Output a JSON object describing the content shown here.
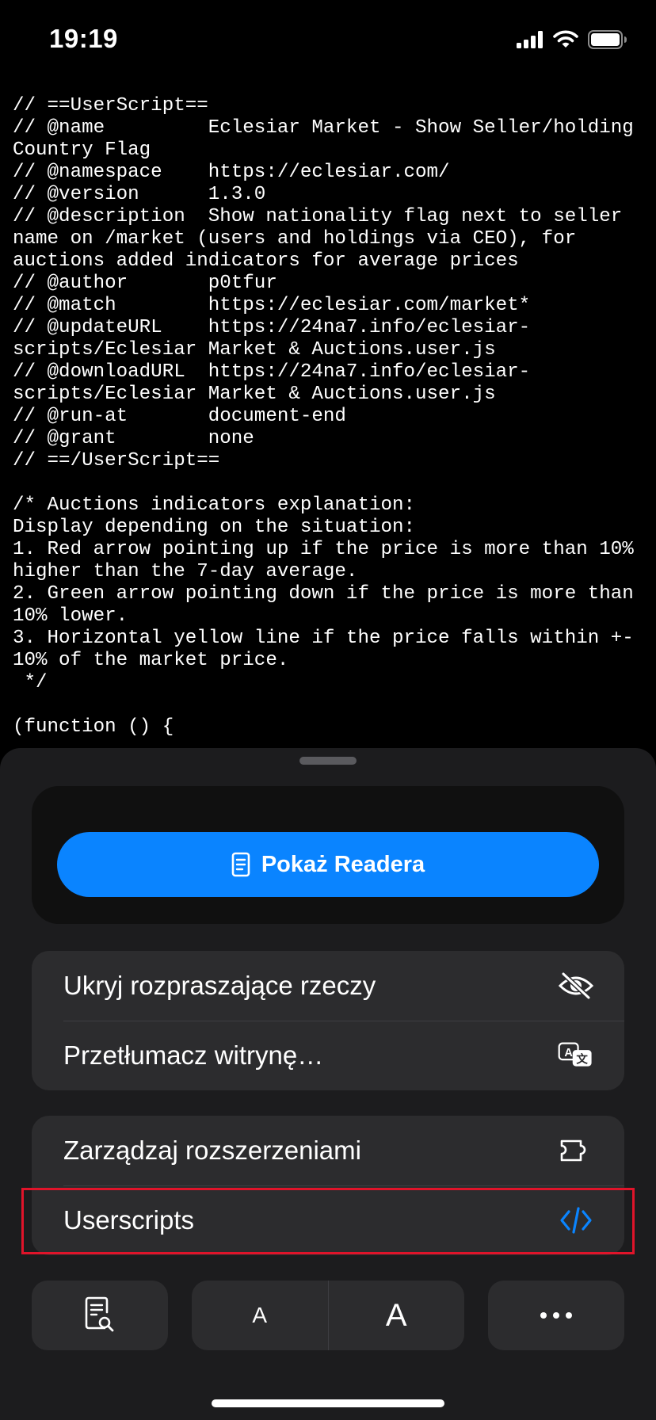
{
  "status_bar": {
    "time": "19:19",
    "icons": [
      "signal-icon",
      "wifi-icon",
      "battery-icon"
    ]
  },
  "code": {
    "text": "// ==UserScript==\n// @name         Eclesiar Market - Show Seller/holding Country Flag\n// @namespace    https://eclesiar.com/\n// @version      1.3.0\n// @description  Show nationality flag next to seller name on /market (users and holdings via CEO), for auctions added indicators for average prices\n// @author       p0tfur\n// @match        https://eclesiar.com/market*\n// @updateURL    https://24na7.info/eclesiar-scripts/Eclesiar Market & Auctions.user.js\n// @downloadURL  https://24na7.info/eclesiar-scripts/Eclesiar Market & Auctions.user.js\n// @run-at       document-end\n// @grant        none\n// ==/UserScript==\n\n/* Auctions indicators explanation:\nDisplay depending on the situation:\n1. Red arrow pointing up if the price is more than 10% higher than the 7-day average.\n2. Green arrow pointing down if the price is more than 10% lower.\n3. Horizontal yellow line if the price falls within +- 10% of the market price.\n */\n\n(function () {"
  },
  "sheet": {
    "reader_button": {
      "label": "Pokaż Readera",
      "icon": "reader-doc-icon"
    },
    "group1": [
      {
        "label": "Ukryj rozpraszające rzeczy",
        "icon": "eye-slash-icon"
      },
      {
        "label": "Przetłumacz witrynę…",
        "icon": "translate-icon"
      }
    ],
    "group2": [
      {
        "label": "Zarządzaj rozszerzeniami",
        "icon": "puzzle-icon"
      },
      {
        "label": "Userscripts",
        "icon": "code-icon"
      }
    ],
    "toolbar": {
      "page_reader_icon": "page-search-icon",
      "font_small": "A",
      "font_large": "A",
      "more_icon": "ellipsis-icon"
    }
  },
  "colors": {
    "accent": "#0a84ff",
    "sheet_bg": "#1c1c1e",
    "row_bg": "#2c2c2e",
    "highlight": "#e0142a"
  }
}
